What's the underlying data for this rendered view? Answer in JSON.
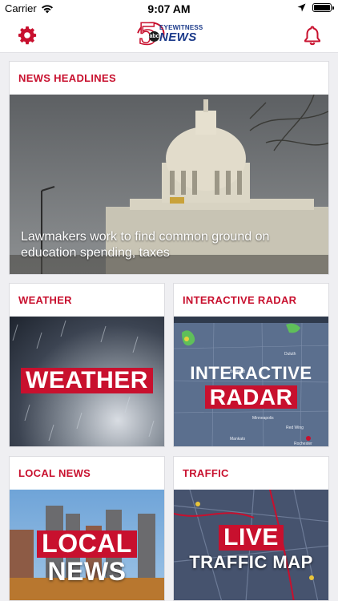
{
  "status": {
    "carrier": "Carrier",
    "time": "9:07 AM"
  },
  "navbar": {
    "logo_top": "EYEWITNESS",
    "logo_news": "NEWS",
    "logo_number": "5",
    "logo_network": "abc"
  },
  "cards": {
    "headlines": {
      "title": "NEWS HEADLINES",
      "headline": "Lawmakers work to find common ground on education spending, taxes"
    },
    "weather": {
      "title": "WEATHER",
      "image_word": "WEATHER"
    },
    "radar": {
      "title": "INTERACTIVE RADAR",
      "line1": "INTERACTIVE",
      "line2": "RADAR",
      "cities": [
        "Duluth",
        "Minneapolis",
        "Mankato",
        "Brainerd",
        "Red Wing",
        "Rochester"
      ]
    },
    "local": {
      "title": "LOCAL NEWS",
      "line1": "LOCAL",
      "line2": "NEWS"
    },
    "traffic": {
      "title": "TRAFFIC",
      "line1": "LIVE",
      "line2": "TRAFFIC MAP"
    }
  },
  "colors": {
    "accent": "#c8102e",
    "brand_blue": "#1b3a8a",
    "background": "#efeff2"
  }
}
